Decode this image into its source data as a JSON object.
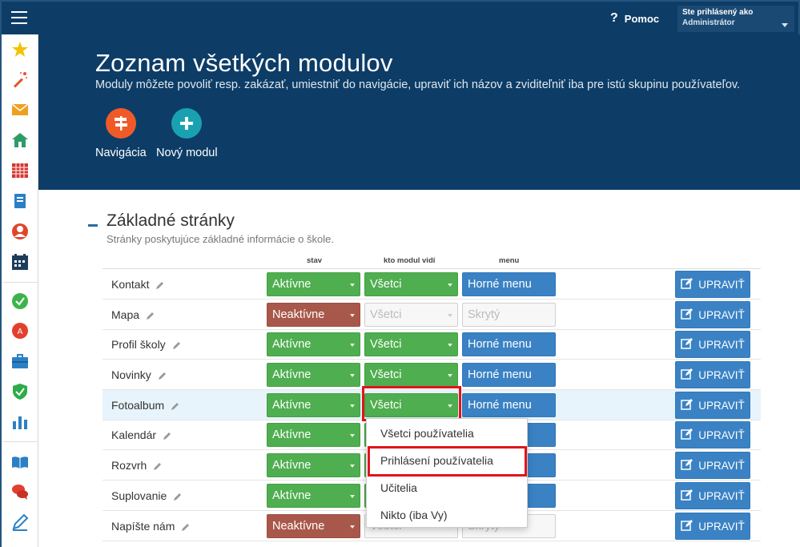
{
  "topbar": {
    "menu_icon": "hamburger-icon",
    "help_label": "Pomoc",
    "help_icon": "question-icon",
    "user_line1": "Ste prihlásený ako",
    "user_line2": "Administrátor"
  },
  "sidebar": {
    "icons": [
      "star-icon",
      "magic-wand-icon",
      "envelope-icon",
      "home-icon",
      "calendar-grid-icon",
      "notebook-icon",
      "user-icon",
      "schedule-icon",
      "check-circle-icon",
      "badge-icon",
      "briefcase-icon",
      "shield-check-icon",
      "bar-chart-icon",
      "book-icon",
      "chat-icon",
      "pencil-icon"
    ]
  },
  "header": {
    "title": "Zoznam všetkých modulov",
    "subtitle": "Moduly môžete povoliť resp. zakázať, umiestniť do navigácie, upraviť ich názov a zviditeľniť iba pre istú skupinu používateľov.",
    "buttons": [
      {
        "label": "Navigácia",
        "icon": "signpost-icon",
        "color": "#f05a28"
      },
      {
        "label": "Nový modul",
        "icon": "plus-icon",
        "color": "#1aa1b1"
      }
    ]
  },
  "section": {
    "title": "Základné stránky",
    "subtitle": "Stránky poskytujúce základné informácie o škole.",
    "col_stav": "stav",
    "col_kto": "kto modul vidí",
    "col_menu": "menu",
    "edit_label": "UPRAVIŤ",
    "rows": [
      {
        "name": "Kontakt",
        "stav": "Aktívne",
        "kto": "Všetci",
        "menu": "Horné menu"
      },
      {
        "name": "Mapa",
        "stav": "Neaktívne",
        "kto": "Všetci",
        "menu": "Skrytý"
      },
      {
        "name": "Profil školy",
        "stav": "Aktívne",
        "kto": "Všetci",
        "menu": "Horné menu"
      },
      {
        "name": "Novinky",
        "stav": "Aktívne",
        "kto": "Všetci",
        "menu": "Horné menu"
      },
      {
        "name": "Fotoalbum",
        "stav": "Aktívne",
        "kto": "Všetci",
        "menu": "Horné menu"
      },
      {
        "name": "Kalendár",
        "stav": "Aktívne",
        "kto": "",
        "menu": ""
      },
      {
        "name": "Rozvrh",
        "stav": "Aktívne",
        "kto": "",
        "menu": ""
      },
      {
        "name": "Suplovanie",
        "stav": "Aktívne",
        "kto": "",
        "menu": ""
      },
      {
        "name": "Napíšte nám",
        "stav": "Neaktívne",
        "kto": "Všetci",
        "menu": "Skrytý"
      }
    ]
  },
  "dropdown": {
    "options": [
      "Všetci používatelia",
      "Prihlásení používatelia",
      "Učitelia",
      "Nikto (iba Vy)"
    ]
  },
  "colors": {
    "navy": "#0d3d66",
    "active_green": "#4fae4f",
    "inactive_red": "#a8584a",
    "menu_blue": "#3a82c4",
    "highlight_red": "#e0141e"
  }
}
